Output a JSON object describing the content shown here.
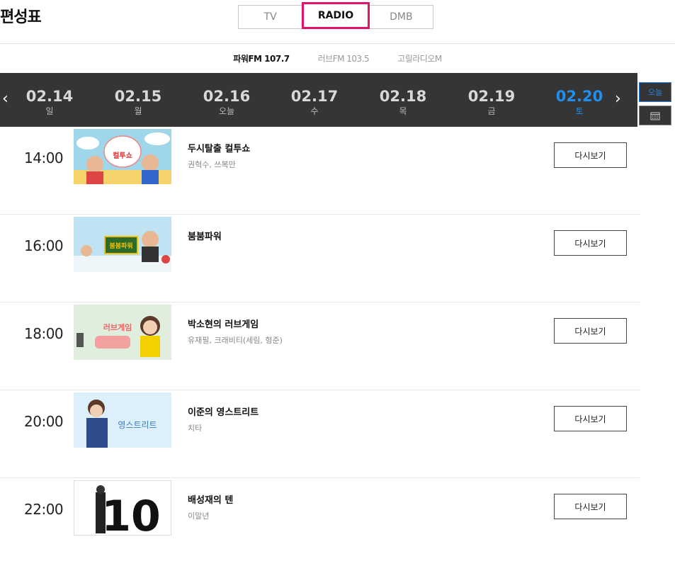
{
  "header": {
    "title": "편성표"
  },
  "media_tabs": [
    {
      "label": "TV",
      "active": false
    },
    {
      "label": "RADIO",
      "active": true
    },
    {
      "label": "DMB",
      "active": false
    }
  ],
  "channel_tabs": [
    {
      "label": "파워FM 107.7",
      "active": true
    },
    {
      "label": "러브FM 103.5",
      "active": false
    },
    {
      "label": "고릴라디오M",
      "active": false
    }
  ],
  "dates": [
    {
      "date": "02.14",
      "day": "일",
      "active": false
    },
    {
      "date": "02.15",
      "day": "월",
      "active": false
    },
    {
      "date": "02.16",
      "day": "오늘",
      "active": false
    },
    {
      "date": "02.17",
      "day": "수",
      "active": false
    },
    {
      "date": "02.18",
      "day": "목",
      "active": false
    },
    {
      "date": "02.19",
      "day": "금",
      "active": false
    },
    {
      "date": "02.20",
      "day": "토",
      "active": true
    }
  ],
  "side": {
    "today_label": "오늘"
  },
  "programs": [
    {
      "time": "14:00",
      "title": "두시탈출 컬투쇼",
      "host": "권혁수, 쓰복만",
      "replay": "다시보기",
      "thumb_text": "컬투쇼"
    },
    {
      "time": "16:00",
      "title": "붐붐파워",
      "host": "",
      "replay": "다시보기",
      "thumb_text": "붐붐파워"
    },
    {
      "time": "18:00",
      "title": "박소현의 러브게임",
      "host": "유재필, 크래비티(세림, 형준)",
      "replay": "다시보기",
      "thumb_text": "러브게임"
    },
    {
      "time": "20:00",
      "title": "이준의 영스트리트",
      "host": "치타",
      "replay": "다시보기",
      "thumb_text": "영스트리트"
    },
    {
      "time": "22:00",
      "title": "배성재의 텐",
      "host": "이말년",
      "replay": "다시보기",
      "thumb_text": "10"
    }
  ]
}
